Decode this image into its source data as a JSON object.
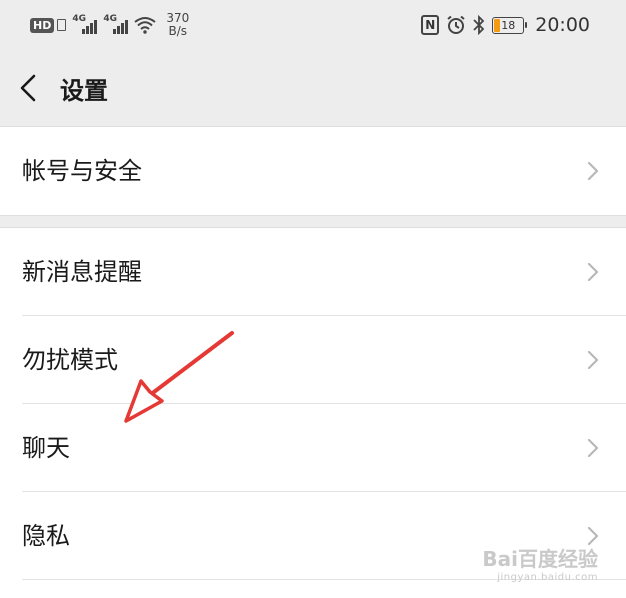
{
  "status_bar": {
    "hd": "HD",
    "net1": "4G",
    "net2": "4G",
    "speed_value": "370",
    "speed_unit": "B/s",
    "battery": "18",
    "time": "20:00",
    "battery_color": "#f39c12"
  },
  "header": {
    "back_icon": "chevron-left-icon",
    "title": "设置"
  },
  "groups": [
    {
      "items": [
        {
          "label": "帐号与安全"
        }
      ]
    },
    {
      "items": [
        {
          "label": "新消息提醒"
        },
        {
          "label": "勿扰模式"
        },
        {
          "label": "聊天"
        },
        {
          "label": "隐私"
        }
      ]
    }
  ],
  "annotation": {
    "arrow_color": "#e53935"
  },
  "watermark": {
    "logo": "Bai百度经验",
    "url": "jingyan.baidu.com"
  }
}
